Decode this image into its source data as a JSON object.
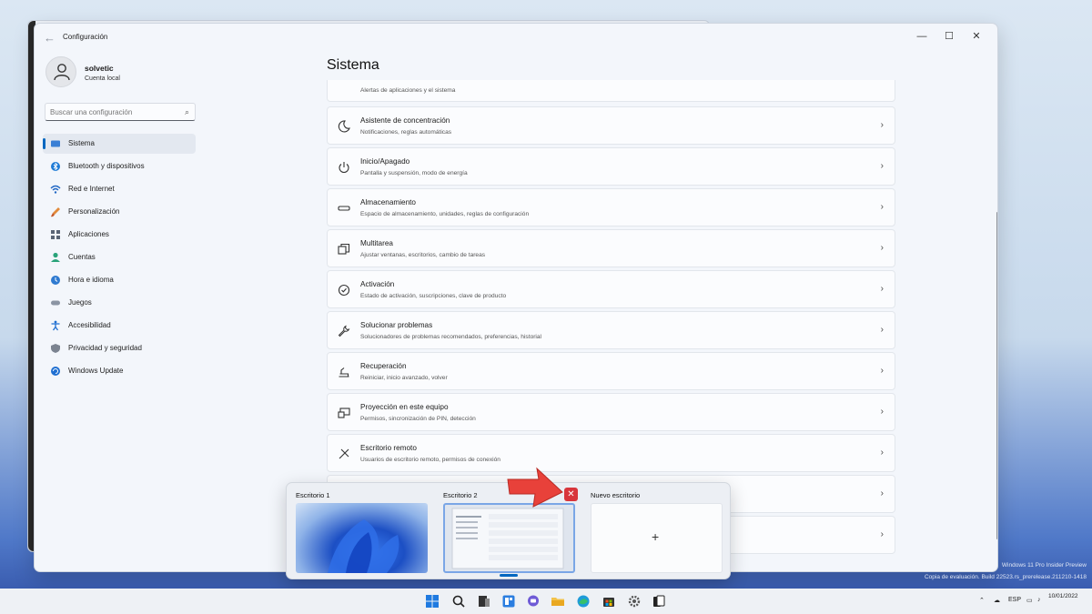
{
  "window": {
    "title": "Configuración",
    "back_icon": "back-arrow-icon",
    "controls": {
      "minimize": "—",
      "maximize": "☐",
      "close": "✕"
    }
  },
  "user": {
    "name": "solvetic",
    "subtitle": "Cuenta local"
  },
  "search": {
    "placeholder": "Buscar una configuración"
  },
  "nav": {
    "items": [
      {
        "label": "Sistema",
        "icon": "monitor-icon",
        "active": true
      },
      {
        "label": "Bluetooth y dispositivos",
        "icon": "bluetooth-icon"
      },
      {
        "label": "Red e Internet",
        "icon": "wifi-icon"
      },
      {
        "label": "Personalización",
        "icon": "brush-icon"
      },
      {
        "label": "Aplicaciones",
        "icon": "apps-icon"
      },
      {
        "label": "Cuentas",
        "icon": "person-icon"
      },
      {
        "label": "Hora e idioma",
        "icon": "globe-clock-icon"
      },
      {
        "label": "Juegos",
        "icon": "gamepad-icon"
      },
      {
        "label": "Accesibilidad",
        "icon": "accessibility-icon"
      },
      {
        "label": "Privacidad y seguridad",
        "icon": "shield-icon"
      },
      {
        "label": "Windows Update",
        "icon": "update-icon"
      }
    ]
  },
  "main": {
    "heading": "Sistema",
    "partial_top_sub": "Alertas de aplicaciones y el sistema",
    "cards": [
      {
        "title": "Asistente de concentración",
        "subtitle": "Notificaciones, reglas automáticas",
        "icon": "moon-icon"
      },
      {
        "title": "Inicio/Apagado",
        "subtitle": "Pantalla y suspensión, modo de energía",
        "icon": "power-icon"
      },
      {
        "title": "Almacenamiento",
        "subtitle": "Espacio de almacenamiento, unidades, reglas de configuración",
        "icon": "storage-icon"
      },
      {
        "title": "Multitarea",
        "subtitle": "Ajustar ventanas, escritorios, cambio de tareas",
        "icon": "multitask-icon"
      },
      {
        "title": "Activación",
        "subtitle": "Estado de activación, suscripciones, clave de producto",
        "icon": "check-circle-icon"
      },
      {
        "title": "Solucionar problemas",
        "subtitle": "Solucionadores de problemas recomendados, preferencias, historial",
        "icon": "wrench-icon"
      },
      {
        "title": "Recuperación",
        "subtitle": "Reiniciar, inicio avanzado, volver",
        "icon": "recovery-icon"
      },
      {
        "title": "Proyección en este equipo",
        "subtitle": "Permisos, sincronización de PIN, detección",
        "icon": "projection-icon"
      },
      {
        "title": "Escritorio remoto",
        "subtitle": "Usuarios de escritorio remoto, permisos de conexión",
        "icon": "remote-icon"
      }
    ]
  },
  "task_view": {
    "desktops": [
      {
        "label": "Escritorio 1"
      },
      {
        "label": "Escritorio 2"
      },
      {
        "label": "Nuevo escritorio"
      }
    ],
    "new_symbol": "+",
    "close_symbol": "✕"
  },
  "taskbar": {
    "language": "ESP",
    "date": "10/01/2022",
    "watermark_line1": "Windows 11 Pro Insider Preview",
    "watermark_line2": "Copia de evaluación. Build 22523.rs_prerelease.211210-1418"
  },
  "colors": {
    "accent": "#0067c0",
    "close_red": "#d8353b",
    "arrow_red": "#e8413a"
  }
}
